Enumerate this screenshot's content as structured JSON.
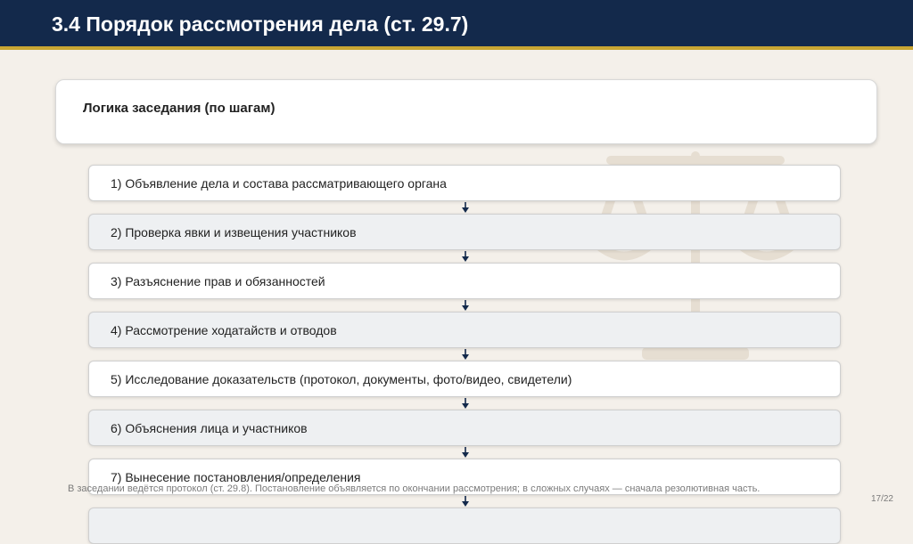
{
  "slide": {
    "title": "3.4 Порядок рассмотрения дела (ст. 29.7)",
    "card_title": "Логика заседания (по шагам)",
    "steps": [
      "1) Объявление дела и состава рассматривающего органа",
      "2) Проверка явки и извещения участников",
      "3) Разъяснение прав и обязанностей",
      "4) Рассмотрение ходатайств и отводов",
      "5) Исследование доказательств (протокол, документы, фото/видео, свидетели)",
      "6) Объяснения лица и участников",
      "7) Вынесение постановления/определения"
    ],
    "footnote": "В заседании ведётся протокол (ст. 29.8). Постановление объявляется по окончании рассмотрения; в сложных случаях — сначала резолютивная часть.",
    "page_number": "17/22",
    "watermark_icon": "scales-of-justice-icon"
  },
  "colors": {
    "header_bg": "#13294b",
    "accent_line": "#c9a633",
    "page_bg": "#f4f0ea",
    "arrow": "#13294b"
  }
}
